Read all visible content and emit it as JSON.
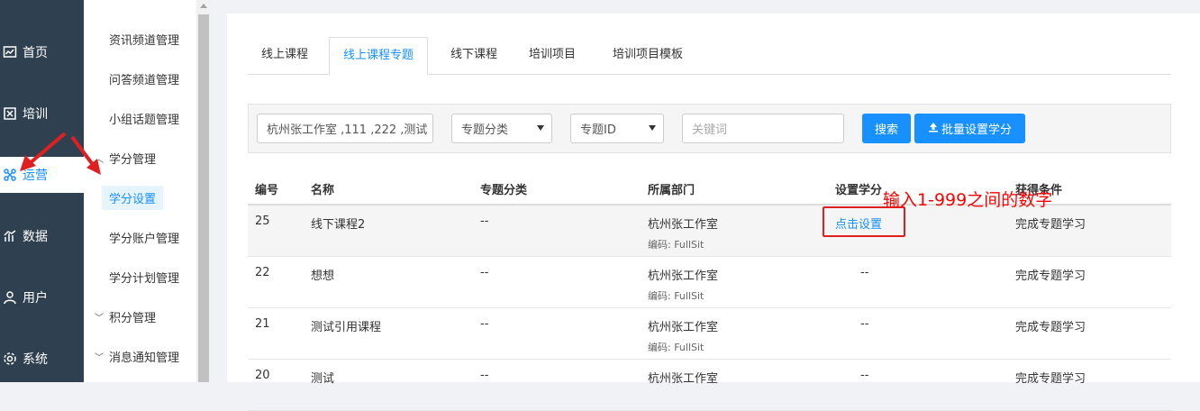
{
  "nav": {
    "items": [
      {
        "label": "首页",
        "icon": "chart-line-icon"
      },
      {
        "label": "培训",
        "icon": "book-icon"
      },
      {
        "label": "运营",
        "icon": "network-icon",
        "active": true
      },
      {
        "label": "数据",
        "icon": "bar-chart-icon"
      },
      {
        "label": "用户",
        "icon": "user-icon"
      },
      {
        "label": "系统",
        "icon": "gear-icon"
      }
    ]
  },
  "submenu": {
    "items": [
      "资讯频道管理",
      "问答频道管理",
      "小组话题管理",
      "学分管理",
      "学分设置",
      "学分账户管理",
      "学分计划管理",
      "积分管理",
      "消息通知管理"
    ]
  },
  "tabs": [
    "线上课程",
    "线上课程专题",
    "线下课程",
    "培训项目",
    "培训项目模板"
  ],
  "filter": {
    "dept_value": "杭州张工作室 ,111 ,222 ,测试",
    "category_select": "专题分类",
    "id_select": "专题ID",
    "keyword_placeholder": "关键词",
    "search_label": "搜索",
    "batch_label": "批量设置学分"
  },
  "table": {
    "headers": [
      "编号",
      "名称",
      "专题分类",
      "所属部门",
      "设置学分",
      "获得条件"
    ],
    "rows": [
      {
        "id": "25",
        "name": "线下课程2",
        "category": "--",
        "dept": "杭州张工作室",
        "code": "编码: FullSit",
        "credit": "点击设置",
        "condition": "完成专题学习"
      },
      {
        "id": "22",
        "name": "想想",
        "category": "--",
        "dept": "杭州张工作室",
        "code": "编码: FullSit",
        "credit": "--",
        "condition": "完成专题学习"
      },
      {
        "id": "21",
        "name": "测试引用课程",
        "category": "--",
        "dept": "杭州张工作室",
        "code": "编码: FullSit",
        "credit": "--",
        "condition": "完成专题学习"
      },
      {
        "id": "20",
        "name": "测试",
        "category": "--",
        "dept": "杭州张工作室",
        "code": "",
        "credit": "--",
        "condition": "完成专题学习"
      }
    ]
  },
  "annotation": "输入1-999之间的数字",
  "colors": {
    "accent": "#1890ff",
    "nav_bg": "#2f4050",
    "annotation": "#ff0000"
  }
}
